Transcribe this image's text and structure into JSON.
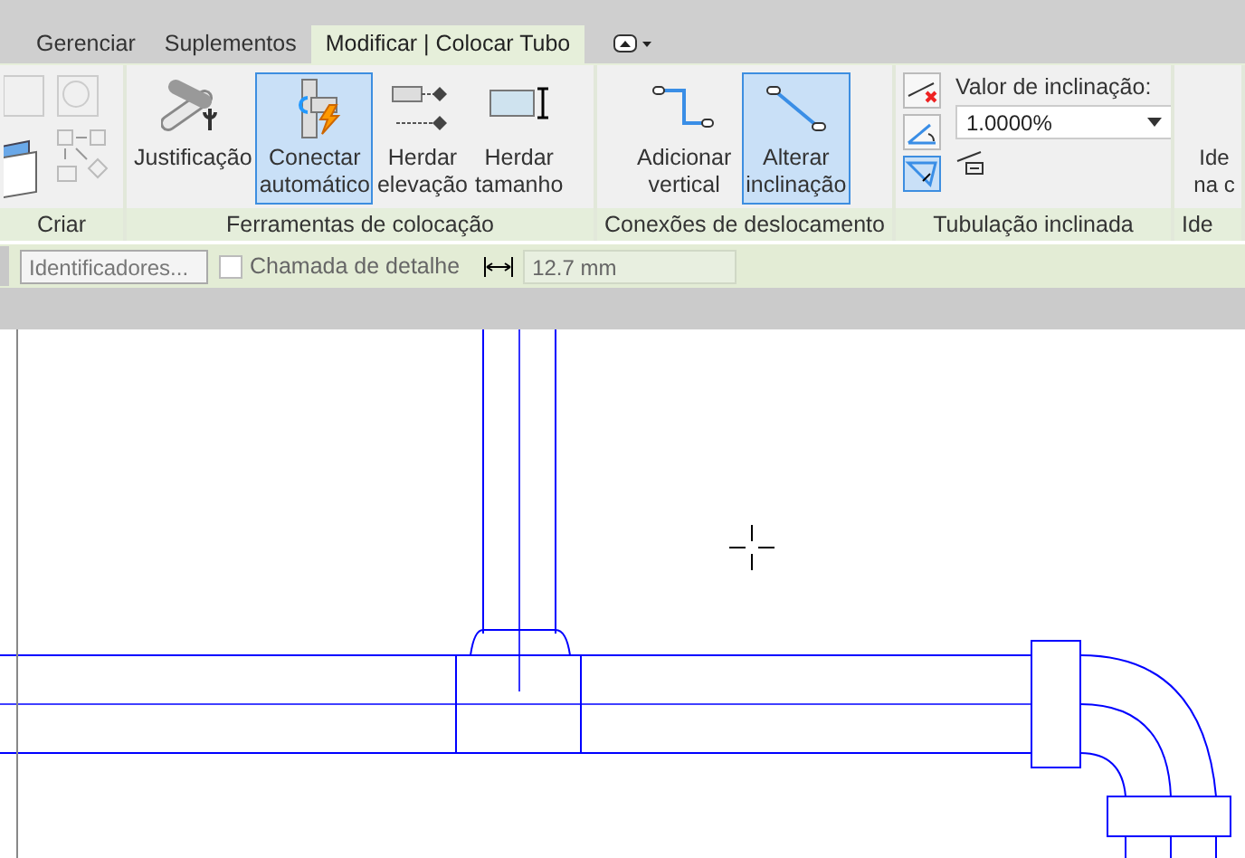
{
  "tabs": [
    {
      "label": "Gerenciar",
      "selected": false
    },
    {
      "label": "Suplementos",
      "selected": false
    },
    {
      "label": "Modificar | Colocar Tubo",
      "selected": true
    }
  ],
  "ribbon_panels": [
    {
      "label": "Criar",
      "kind": "icons"
    },
    {
      "label": "Ferramentas de colocação",
      "kind": "buttons",
      "buttons": [
        {
          "lines": [
            "Justificação"
          ],
          "selected": false
        },
        {
          "lines": [
            "Conectar",
            "automático"
          ],
          "selected": true
        },
        {
          "lines": [
            "Herdar",
            "elevação"
          ],
          "selected": false
        },
        {
          "lines": [
            "Herdar",
            "tamanho"
          ],
          "selected": false
        }
      ]
    },
    {
      "label": "Conexões de deslocamento",
      "kind": "buttons",
      "buttons": [
        {
          "lines": [
            "Adicionar",
            "vertical"
          ],
          "selected": false
        },
        {
          "lines": [
            "Alterar",
            "inclinação"
          ],
          "selected": true
        }
      ]
    },
    {
      "label": "Tubulação inclinada",
      "kind": "slope",
      "slope_buttons": [
        {
          "selected": false
        },
        {
          "selected": false
        },
        {
          "selected": true
        }
      ],
      "field_label": "Valor de inclinação:",
      "value": "1.0000%"
    },
    {
      "label": "Ide",
      "kind": "buttons",
      "buttons": [
        {
          "lines": [
            "Ide",
            "na c"
          ],
          "selected": false
        }
      ]
    }
  ],
  "options_bar": {
    "tags_button": "Identificadores...",
    "detail_callout": {
      "label": "Chamada de detalhe",
      "checked": false
    },
    "offset": "12.7 mm"
  }
}
